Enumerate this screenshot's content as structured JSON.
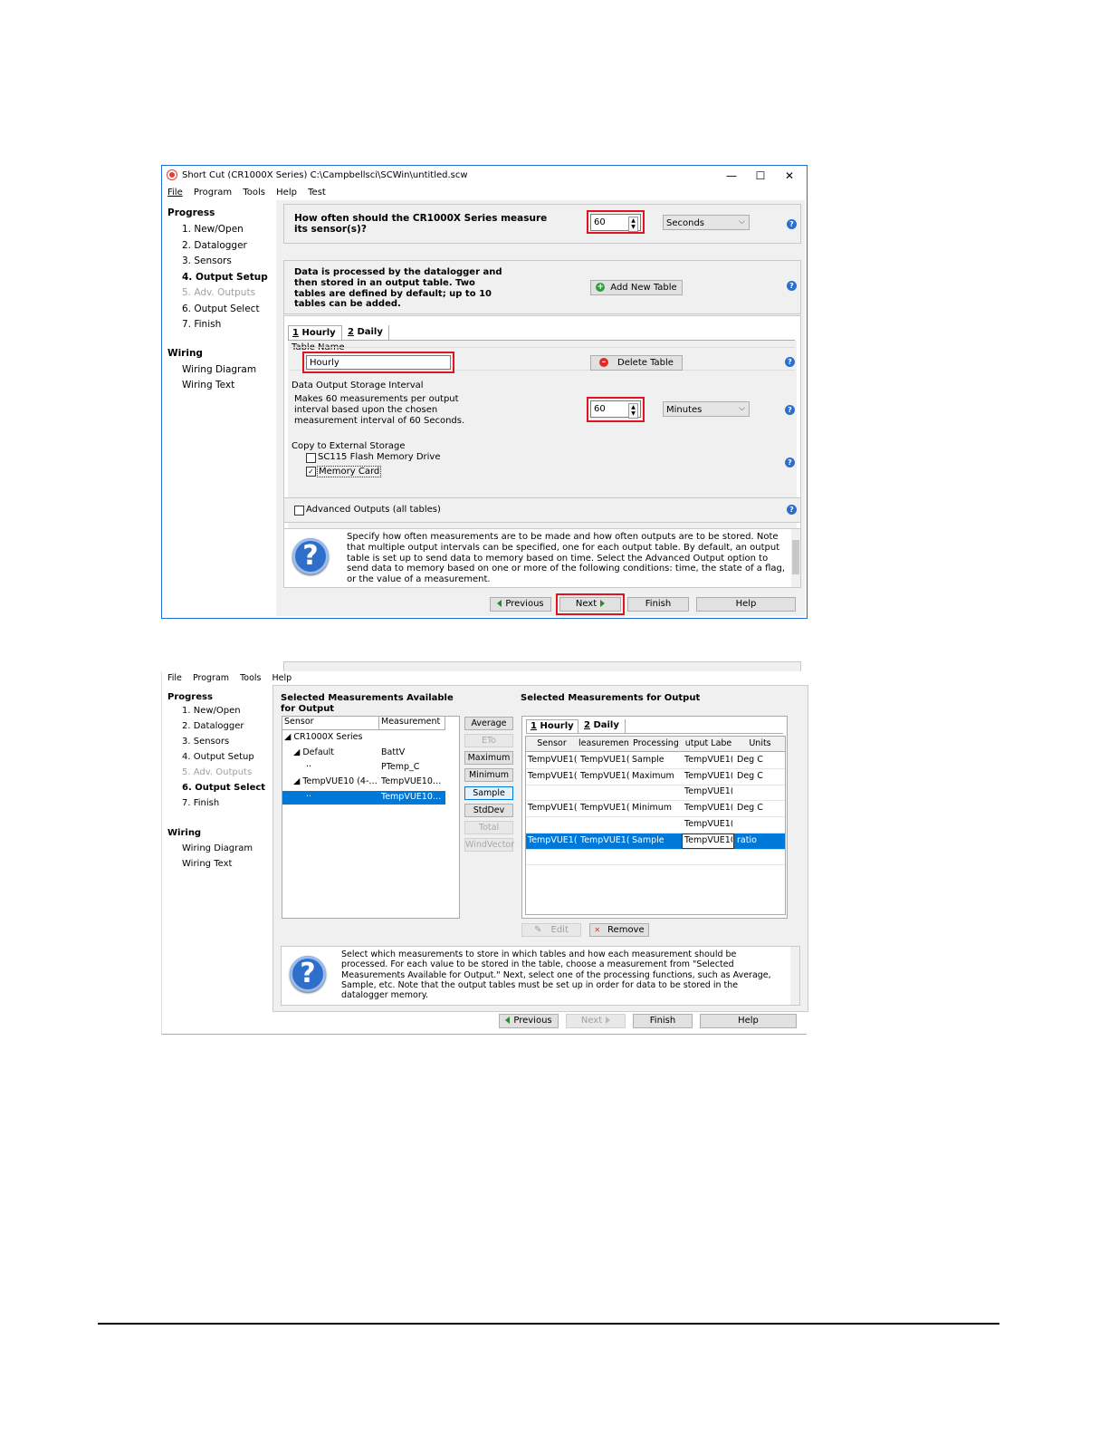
{
  "window1": {
    "title": "Short Cut (CR1000X Series) C:\\Campbellsci\\SCWin\\untitled.scw",
    "controls": {
      "minimize": "—",
      "maximize": "☐",
      "close": "✕"
    },
    "menu": [
      "File",
      "Program",
      "Tools",
      "Help",
      "Test"
    ],
    "nav": {
      "progress_heading": "Progress",
      "progress_items": [
        "1. New/Open",
        "2. Datalogger",
        "3. Sensors",
        "4. Output Setup",
        "5. Adv. Outputs",
        "6. Output Select",
        "7. Finish"
      ],
      "active_index": 3,
      "disabled_index": 4,
      "wiring_heading": "Wiring",
      "wiring_items": [
        "Wiring Diagram",
        "Wiring Text"
      ]
    },
    "measure_question": "How often should the CR1000X Series measure its sensor(s)?",
    "scan_interval": "60",
    "scan_units": "Seconds",
    "tables_info": "Data is processed by the datalogger and then stored in an output table. Two tables are defined by default; up to 10 tables can be added.",
    "add_table_label": "Add New Table",
    "tabs": [
      {
        "num": "1",
        "label": " Hourly"
      },
      {
        "num": "2",
        "label": " Daily"
      }
    ],
    "table_name_label": "Table Name",
    "table_name_value": "Hourly",
    "delete_table_label": "Delete Table",
    "storage_interval_label": "Data Output Storage Interval",
    "storage_interval_desc": "Makes 60 measurements per output interval based upon the chosen measurement interval of 60 Seconds.",
    "output_interval": "60",
    "output_units": "Minutes",
    "copy_external_label": "Copy to External Storage",
    "sc115_label": "SC115 Flash Memory Drive",
    "sc115_checked": false,
    "memory_card_label": "Memory Card",
    "memory_card_checked": true,
    "advanced_outputs_label": "Advanced Outputs (all tables)",
    "advanced_outputs_checked": false,
    "info_text": "Specify how often measurements are to be made and how often outputs are to be stored. Note that multiple output intervals can be specified, one for each output table. By default, an output table is set up to send data to memory based on time. Select the Advanced Output option to send data to memory based on one or more of the following conditions: time, the state of a flag, or the value of a measurement.",
    "buttons": {
      "previous": "Previous",
      "next": "Next",
      "finish": "Finish",
      "help": "Help"
    }
  },
  "window2": {
    "menu": [
      "File",
      "Program",
      "Tools",
      "Help"
    ],
    "nav": {
      "progress_heading": "Progress",
      "progress_items": [
        "1. New/Open",
        "2. Datalogger",
        "3. Sensors",
        "4. Output Setup",
        "5. Adv. Outputs",
        "6. Output Select",
        "7. Finish"
      ],
      "active_index": 5,
      "disabled_index": 4,
      "wiring_heading": "Wiring",
      "wiring_items": [
        "Wiring Diagram",
        "Wiring Text"
      ]
    },
    "available_heading": "Selected Measurements Available for Output",
    "available_columns": [
      "Sensor",
      "Measurement"
    ],
    "available_rows": [
      {
        "sensor": "◢ CR1000X Series",
        "measurement": ""
      },
      {
        "sensor": "◢ Default",
        "measurement": "BattV"
      },
      {
        "sensor": "··",
        "measurement": "PTemp_C"
      },
      {
        "sensor": "◢ TempVUE10 (4-…",
        "measurement": "TempVUE10…"
      },
      {
        "sensor": "··",
        "measurement": "TempVUE10…"
      }
    ],
    "available_selected_index": 4,
    "processing_buttons": [
      {
        "label": "Average",
        "state": "normal"
      },
      {
        "label": "ETo",
        "state": "disabled"
      },
      {
        "label": "Maximum",
        "state": "normal"
      },
      {
        "label": "Minimum",
        "state": "normal"
      },
      {
        "label": "Sample",
        "state": "selected"
      },
      {
        "label": "StdDev",
        "state": "normal"
      },
      {
        "label": "Total",
        "state": "disabled"
      },
      {
        "label": "WindVector",
        "state": "disabled"
      }
    ],
    "output_heading": "Selected Measurements for Output",
    "tabs": [
      {
        "num": "1",
        "label": " Hourly"
      },
      {
        "num": "2",
        "label": " Daily"
      }
    ],
    "output_columns": [
      "Sensor",
      "leasuremen",
      "Processing",
      "utput Labe",
      "Units"
    ],
    "output_rows": [
      [
        "TempVUE1(",
        "TempVUE1(",
        "Sample",
        "TempVUE1(",
        "Deg C"
      ],
      [
        "TempVUE1(",
        "TempVUE1(",
        "Maximum",
        "TempVUE1(",
        "Deg C"
      ],
      [
        "",
        "",
        "",
        "TempVUE1(",
        ""
      ],
      [
        "TempVUE1(",
        "TempVUE1(",
        "Minimum",
        "TempVUE1(",
        "Deg C"
      ],
      [
        "",
        "",
        "",
        "TempVUE1(",
        ""
      ],
      [
        "TempVUE1(",
        "TempVUE1(",
        "Sample",
        "TempVUE10",
        "ratio"
      ],
      [
        "",
        "",
        "",
        "",
        ""
      ]
    ],
    "output_selected_index": 5,
    "edit_label": "Edit",
    "remove_label": "Remove",
    "info_text": "Select which measurements to store in which tables and how each measurement should be processed. For each value to be stored in the table, choose a measurement from \"Selected Measurements Available for Output.\" Next, select one of the processing functions, such as Average, Sample, etc. Note that the output tables must be set up in order for data to be stored in the datalogger memory.",
    "buttons": {
      "previous": "Previous",
      "next": "Next",
      "finish": "Finish",
      "help": "Help"
    }
  },
  "colors": {
    "highlight": "#e0141e",
    "selection": "#0078d7",
    "help_icon": "#2a6fcf"
  }
}
